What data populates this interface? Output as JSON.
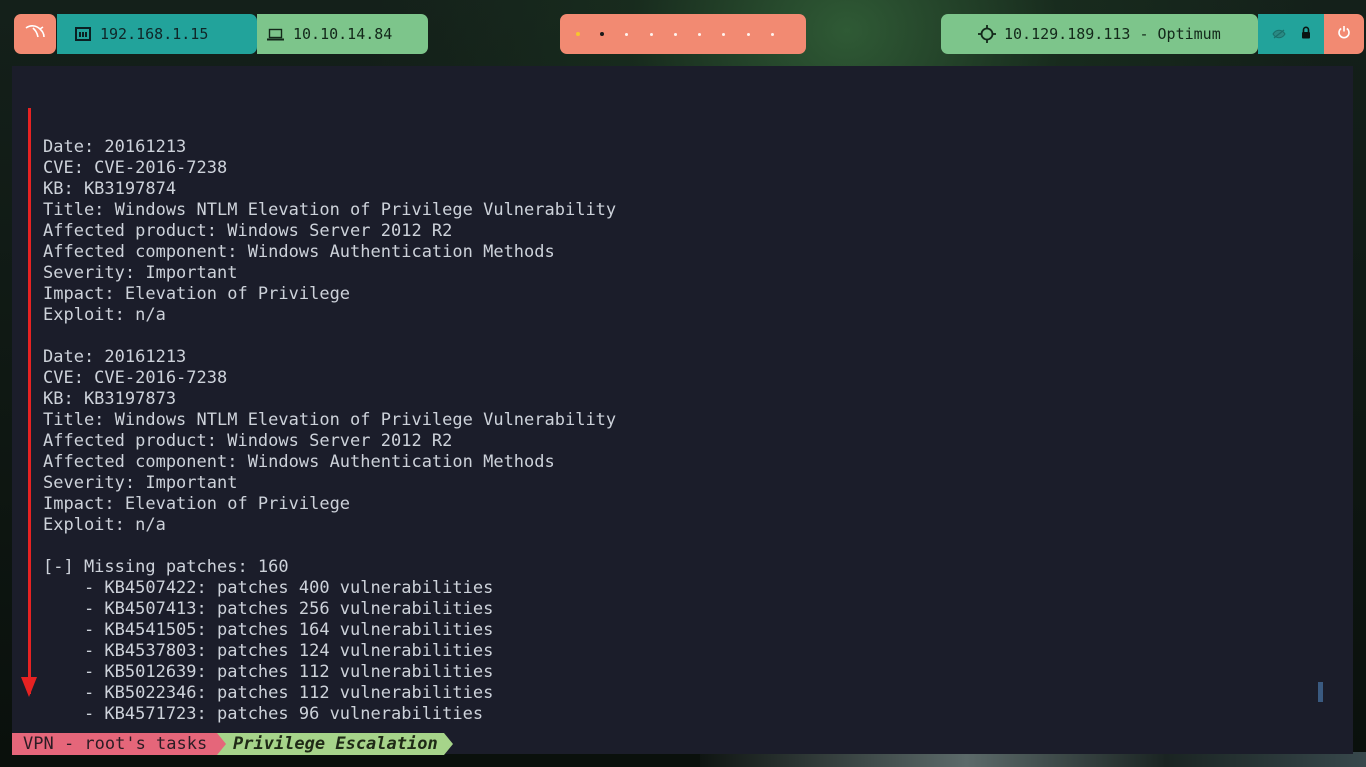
{
  "topbar": {
    "lan_ip": "192.168.1.15",
    "vpn_ip": "10.10.14.84",
    "target": "10.129.189.113 - Optimum",
    "workspaces_count": 9,
    "current_workspace": 1,
    "active_workspace": 2
  },
  "terminal": {
    "lines": [
      "",
      "Date: 20161213",
      "CVE: CVE-2016-7238",
      "KB: KB3197874",
      "Title: Windows NTLM Elevation of Privilege Vulnerability",
      "Affected product: Windows Server 2012 R2",
      "Affected component: Windows Authentication Methods",
      "Severity: Important",
      "Impact: Elevation of Privilege",
      "Exploit: n/a",
      "",
      "Date: 20161213",
      "CVE: CVE-2016-7238",
      "KB: KB3197873",
      "Title: Windows NTLM Elevation of Privilege Vulnerability",
      "Affected product: Windows Server 2012 R2",
      "Affected component: Windows Authentication Methods",
      "Severity: Important",
      "Impact: Elevation of Privilege",
      "Exploit: n/a",
      "",
      "[-] Missing patches: 160",
      "    - KB4507422: patches 400 vulnerabilities",
      "    - KB4507413: patches 256 vulnerabilities",
      "    - KB4541505: patches 164 vulnerabilities",
      "    - KB4537803: patches 124 vulnerabilities",
      "    - KB5012639: patches 112 vulnerabilities",
      "    - KB5022346: patches 112 vulnerabilities",
      "    - KB4571723: patches 96 vulnerabilities"
    ]
  },
  "statusbar": {
    "session": "VPN - root's tasks",
    "window": "Privilege Escalation"
  },
  "colors": {
    "salmon": "#f28a72",
    "teal": "#22a39b",
    "green": "#7dc58b",
    "terminal_bg": "#1b1d2a",
    "arrow": "#e62222"
  },
  "icons": {
    "launcher": "kali-dragon-icon",
    "lan": "ethernet-icon",
    "vpn": "laptop-icon",
    "target": "crosshair-icon",
    "extra1": "eye-off-icon",
    "extra2": "lock-icon",
    "power": "power-icon"
  }
}
